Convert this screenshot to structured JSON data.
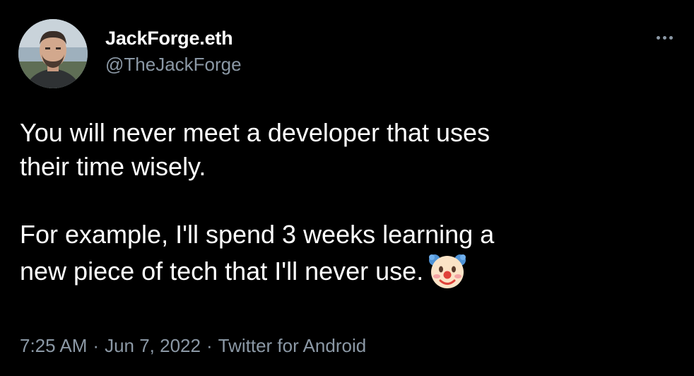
{
  "tweet": {
    "author": {
      "display_name": "JackForge.eth",
      "handle": "@TheJackForge",
      "avatar_icon": "avatar-photo"
    },
    "more_icon": "more-options-icon",
    "text": {
      "paragraph_1_line_1": "You will never meet a developer that uses",
      "paragraph_1_line_2": "their time wisely.",
      "paragraph_2_line_1": "For example, I'll spend 3 weeks learning a",
      "paragraph_2_line_2": "new piece of tech that I'll never use.",
      "emoji": "clown-face-emoji"
    },
    "meta": {
      "time": "7:25 AM",
      "separator": "·",
      "date": "Jun 7, 2022",
      "source": "Twitter for Android"
    }
  },
  "colors": {
    "background": "#000000",
    "primary_text": "#ffffff",
    "secondary_text": "#8b98a5"
  }
}
